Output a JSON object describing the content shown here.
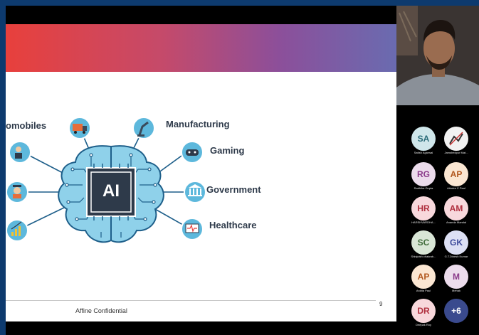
{
  "slide": {
    "footer": "Affine Confidential",
    "page_number": "9",
    "chip_label": "AI",
    "labels": {
      "automobiles": "omobiles",
      "manufacturing": "Manufacturing",
      "gaming": "Gaming",
      "government": "Government",
      "healthcare": "Healthcare"
    }
  },
  "participants": [
    {
      "initials": "SA",
      "name": "Satish Agarwal",
      "bg": "#cfe6ea",
      "fg": "#2a6b78"
    },
    {
      "initials": "",
      "name": "Jamshedpur Mat...",
      "bg": "#f2f2f2",
      "fg": "#333"
    },
    {
      "initials": "RG",
      "name": "Radhika Gupta",
      "bg": "#ecdcec",
      "fg": "#8a3a8a"
    },
    {
      "initials": "AP",
      "name": "Atindra C Paul",
      "bg": "#fbe6d2",
      "fg": "#b2571e"
    },
    {
      "initials": "HR",
      "name": "HARSHVARDHA...",
      "bg": "#f8d8dc",
      "fg": "#b0303f"
    },
    {
      "initials": "AM",
      "name": "Ananda Mandal",
      "bg": "#f8d8dc",
      "fg": "#b0303f"
    },
    {
      "initials": "SC",
      "name": "Shinjoish chakrab...",
      "bg": "#d9e6d6",
      "fg": "#3f6b3a"
    },
    {
      "initials": "GK",
      "name": "G.T.Dinesh Kumar",
      "bg": "#dde0f4",
      "fg": "#3d4a9b"
    },
    {
      "initials": "AP",
      "name": "Ankita Paul",
      "bg": "#fbe6d2",
      "fg": "#b2571e"
    },
    {
      "initials": "M",
      "name": "Mehak",
      "bg": "#ecdcec",
      "fg": "#8a3a8a"
    },
    {
      "initials": "DR",
      "name": "Deepak Roy",
      "bg": "#f8d8dc",
      "fg": "#b0303f"
    },
    {
      "initials": "+6",
      "name": "",
      "bg": "#3a4a8e",
      "fg": "#ffffff"
    }
  ],
  "colors": {
    "icon_circle": "#5db8dc",
    "brain": "#8fd1ea",
    "brain_stroke": "#1e5f8a",
    "chip": "#2e3a4a"
  }
}
